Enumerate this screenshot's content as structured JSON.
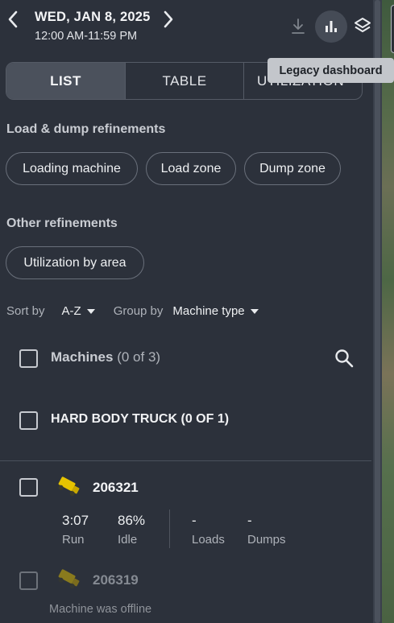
{
  "header": {
    "date": "WED, JAN 8, 2025",
    "time_range": "12:00 AM-11:59 PM",
    "prev_icon": "chevron-left-icon",
    "next_icon": "chevron-right-icon",
    "download_icon": "download-icon",
    "dashboard_icon": "bar-chart-icon",
    "layers_icon": "layers-icon",
    "tooltip": "Legacy dashboard"
  },
  "tabs": [
    {
      "label": "LIST",
      "active": true
    },
    {
      "label": "TABLE",
      "active": false
    },
    {
      "label": "UTILIZATION",
      "active": false
    }
  ],
  "load_dump": {
    "title": "Load & dump refinements",
    "chips": [
      "Loading machine",
      "Load zone",
      "Dump zone"
    ]
  },
  "other": {
    "title": "Other refinements",
    "chips": [
      "Utilization by area"
    ]
  },
  "sort": {
    "sort_label": "Sort by",
    "sort_value": "A-Z",
    "group_label": "Group by",
    "group_value": "Machine type"
  },
  "machines": {
    "label": "Machines",
    "count": "(0 of 3)",
    "search_icon": "search-icon"
  },
  "group": {
    "label": "HARD BODY TRUCK (0 OF 1)"
  },
  "items": [
    {
      "id": "206321",
      "icon": "dump-truck-icon",
      "stats": [
        {
          "value": "3:07",
          "label": "Run"
        },
        {
          "value": "86%",
          "label": "Idle"
        },
        {
          "value": "-",
          "label": "Loads"
        },
        {
          "value": "-",
          "label": "Dumps"
        }
      ]
    },
    {
      "id": "206319",
      "icon": "dump-truck-icon",
      "note": "Machine was offline"
    }
  ],
  "colors": {
    "panel_bg": "#2c313b",
    "active_tab_bg": "#4b515c",
    "truck_yellow": "#e6c300",
    "tooltip_bg": "#c3c6cb"
  }
}
